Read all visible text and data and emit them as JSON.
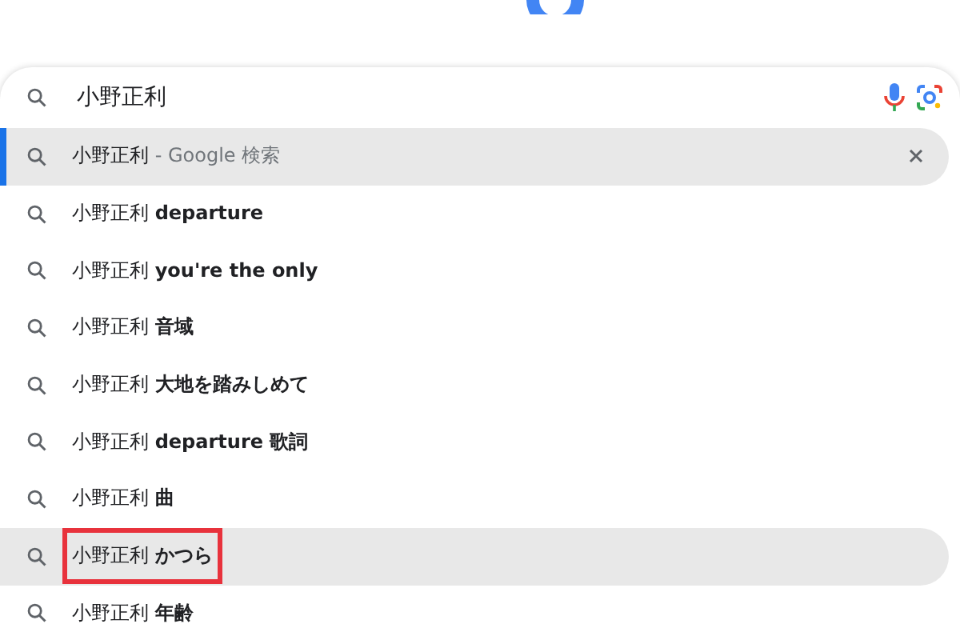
{
  "search": {
    "value": "小野正利"
  },
  "suggestions": [
    {
      "kind": "query",
      "text": "小野正利",
      "suffix": "- Google 検索",
      "selected": true,
      "highlighted": true,
      "outlined": false,
      "removable": true
    },
    {
      "kind": "completion",
      "text": "小野正利",
      "suffix": "departure",
      "selected": false,
      "highlighted": false,
      "outlined": false,
      "removable": false
    },
    {
      "kind": "completion",
      "text": "小野正利",
      "suffix": "you're the only",
      "selected": false,
      "highlighted": false,
      "outlined": false,
      "removable": false
    },
    {
      "kind": "completion",
      "text": "小野正利",
      "suffix": "音域",
      "selected": false,
      "highlighted": false,
      "outlined": false,
      "removable": false
    },
    {
      "kind": "completion",
      "text": "小野正利",
      "suffix": "大地を踏みしめて",
      "selected": false,
      "highlighted": false,
      "outlined": false,
      "removable": false
    },
    {
      "kind": "completion",
      "text": "小野正利",
      "suffix": "departure 歌詞",
      "selected": false,
      "highlighted": false,
      "outlined": false,
      "removable": false
    },
    {
      "kind": "completion",
      "text": "小野正利",
      "suffix": "曲",
      "selected": false,
      "highlighted": false,
      "outlined": false,
      "removable": false
    },
    {
      "kind": "completion",
      "text": "小野正利",
      "suffix": "かつら",
      "selected": false,
      "highlighted": true,
      "outlined": true,
      "removable": false
    },
    {
      "kind": "completion",
      "text": "小野正利",
      "suffix": "年齢",
      "selected": false,
      "highlighted": false,
      "outlined": false,
      "removable": false
    }
  ]
}
